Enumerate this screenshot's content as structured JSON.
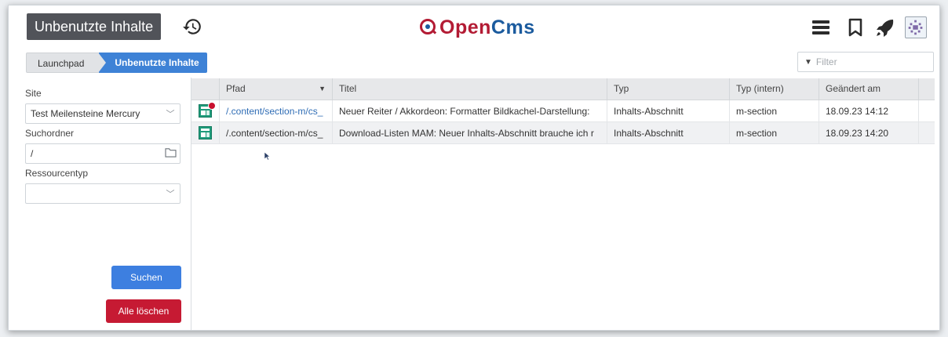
{
  "header": {
    "app_title": "Unbenutzte Inhalte",
    "logo_text_a": "Open",
    "logo_text_b": "Cms"
  },
  "breadcrumb": {
    "home": "Launchpad",
    "current": "Unbenutzte Inhalte"
  },
  "filter": {
    "placeholder": "Filter"
  },
  "left_panel": {
    "site_label": "Site",
    "site_value": "Test Meilensteine Mercury",
    "folder_label": "Suchordner",
    "folder_value": "/",
    "restype_label": "Ressourcentyp",
    "restype_value": "",
    "search_button": "Suchen",
    "clear_button": "Alle löschen"
  },
  "table": {
    "columns": [
      "Pfad",
      "Titel",
      "Typ",
      "Typ (intern)",
      "Geändert am"
    ],
    "rows": [
      {
        "path": "/.content/section-m/cs_",
        "title": "Neuer Reiter / Akkordeon: Formatter Bildkachel-Darstellung:",
        "type": "Inhalts-Abschnitt",
        "itype": "m-section",
        "date": "18.09.23 14:12"
      },
      {
        "path": "/.content/section-m/cs_",
        "title": "Download-Listen MAM: Neuer Inhalts-Abschnitt brauche ich r",
        "type": "Inhalts-Abschnitt",
        "itype": "m-section",
        "date": "18.09.23 14:20"
      }
    ]
  },
  "colors": {
    "brand_red": "#b31b34",
    "brand_blue": "#1b5b9e",
    "accent_blue": "#3d7fe0",
    "danger_red": "#c61a33",
    "title_bg": "#515359"
  }
}
